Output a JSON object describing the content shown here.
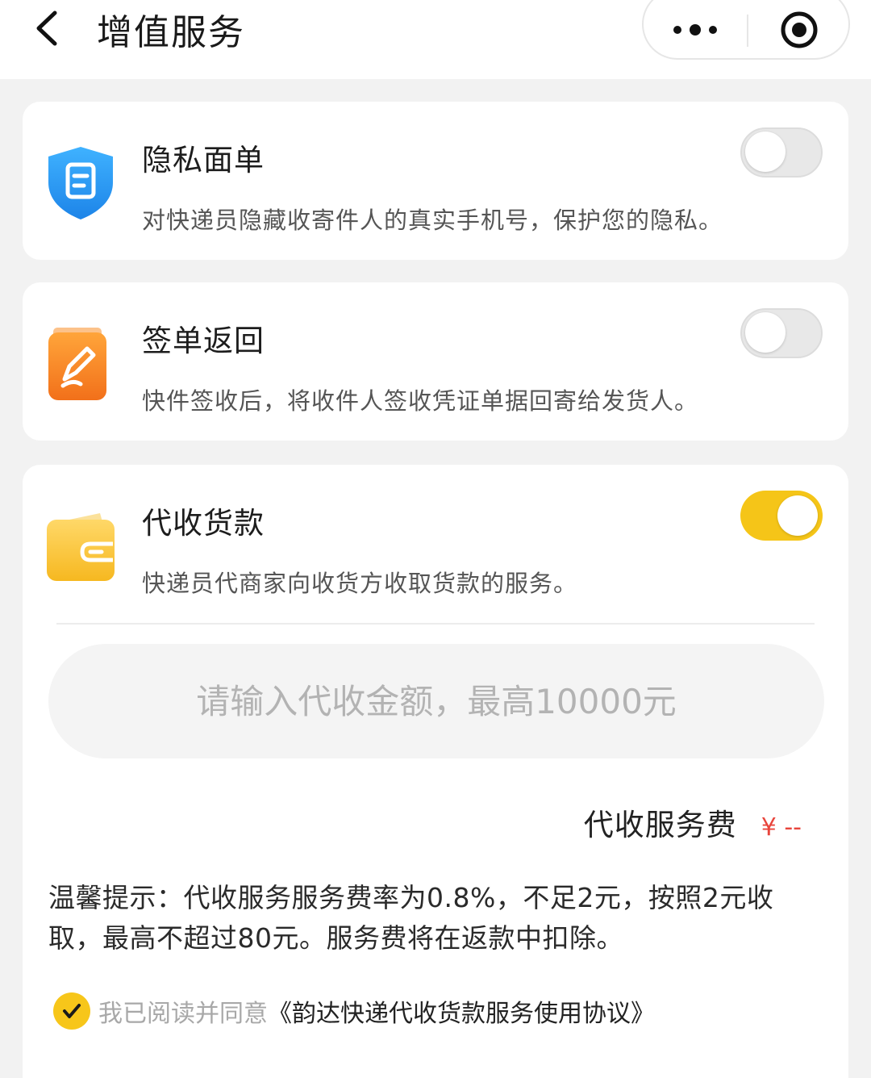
{
  "header": {
    "title": "增值服务"
  },
  "services": [
    {
      "title": "隐私面单",
      "description": "对快递员隐藏收寄件人的真实手机号，保护您的隐私。",
      "icon": "shield-icon",
      "icon_color": "#2a9df4",
      "enabled": false
    },
    {
      "title": "签单返回",
      "description": "快件签收后，将收件人签收凭证单据回寄给发货人。",
      "icon": "signature-pen-icon",
      "icon_color": "#f57c1f",
      "enabled": false
    },
    {
      "title": "代收货款",
      "description": "快递员代商家向收货方收取货款的服务。",
      "icon": "wallet-icon",
      "icon_color": "#f8c332",
      "enabled": true
    }
  ],
  "cod": {
    "amount_placeholder": "请输入代收金额，最高10000元",
    "amount_value": "",
    "fee_label": "代收服务费",
    "fee_value": "¥ --",
    "tip": "温馨提示：代收服务服务费率为0.8%，不足2元，按照2元收取，最高不超过80元。服务费将在返款中扣除。",
    "agree_prefix": "我已阅读并同意",
    "agree_link": "《韵达快递代收货款服务使用协议》",
    "agreed": true
  },
  "colors": {
    "accent": "#f5c518",
    "fee": "#e8453c",
    "background": "#f2f2f2"
  }
}
